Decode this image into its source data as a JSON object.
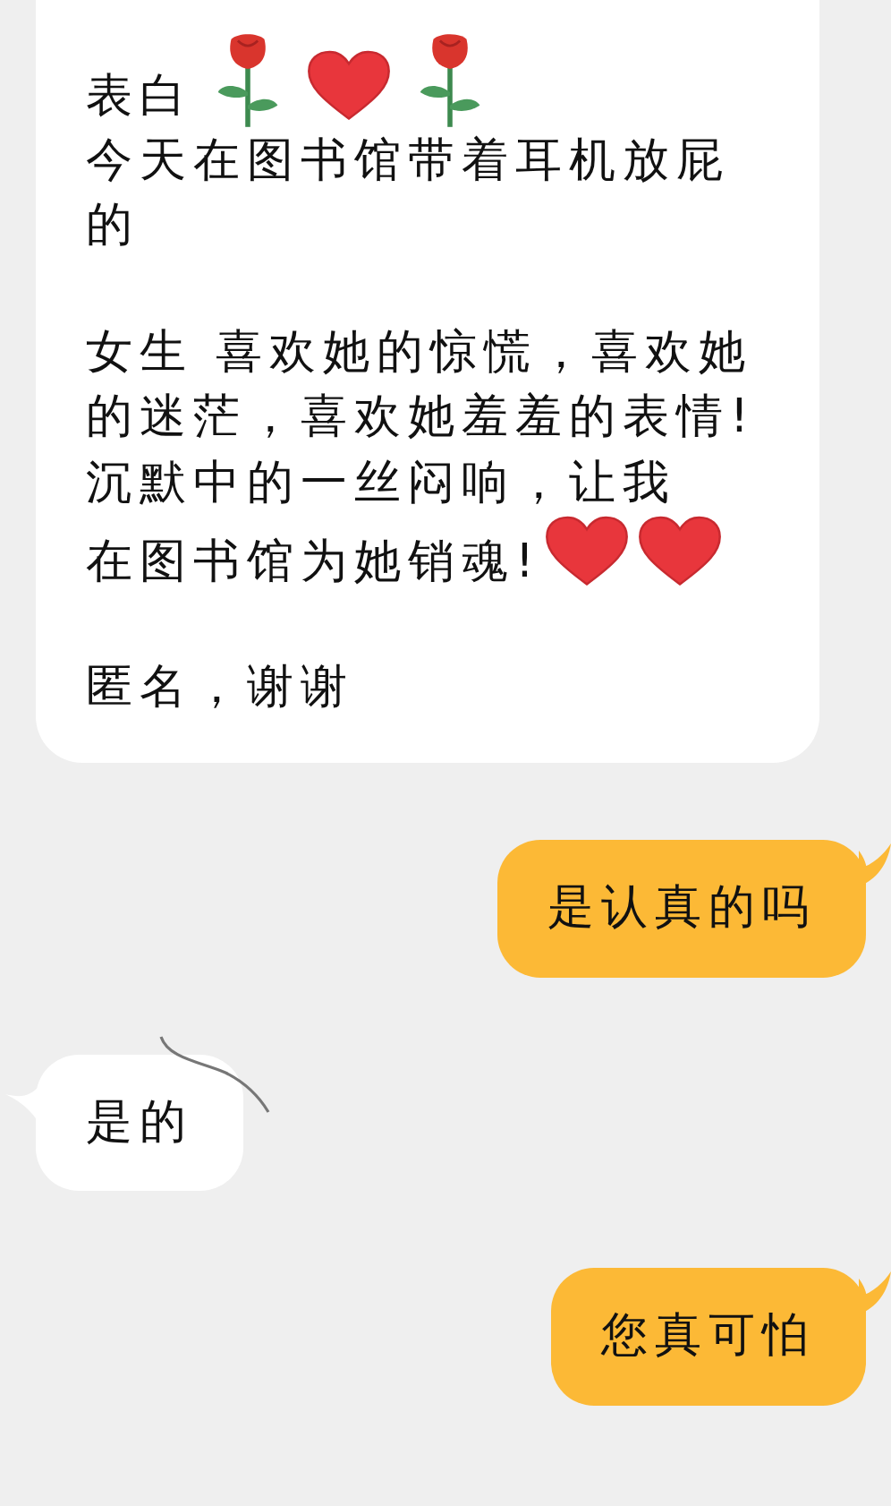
{
  "messages": [
    {
      "kind": "received",
      "cropped_top": true,
      "blocks": [
        [
          [
            {
              "kind": "text",
              "text": "表白"
            },
            {
              "kind": "rose"
            },
            {
              "kind": "heart"
            },
            {
              "kind": "rose"
            }
          ],
          [
            {
              "kind": "text",
              "text": "今天在图书馆带着耳机放屁的"
            }
          ]
        ],
        [
          [
            {
              "kind": "text",
              "text": "女生  喜欢她的惊慌，喜欢她的迷茫，喜欢她羞羞的表情!沉默中的一丝闷响，让我"
            }
          ],
          [
            {
              "kind": "text",
              "text": "在图书馆为她销魂!"
            },
            {
              "kind": "heart"
            },
            {
              "kind": "heart"
            }
          ]
        ],
        [
          [
            {
              "kind": "text",
              "text": "匿名，谢谢"
            }
          ]
        ]
      ]
    },
    {
      "kind": "sent",
      "blocks": [
        [
          [
            {
              "kind": "text",
              "text": "是认真的吗"
            }
          ]
        ]
      ]
    },
    {
      "kind": "received",
      "blocks": [
        [
          [
            {
              "kind": "text",
              "text": "是的"
            }
          ]
        ]
      ]
    },
    {
      "kind": "sent",
      "blocks": [
        [
          [
            {
              "kind": "text",
              "text": "您真可怕"
            }
          ]
        ]
      ]
    }
  ]
}
